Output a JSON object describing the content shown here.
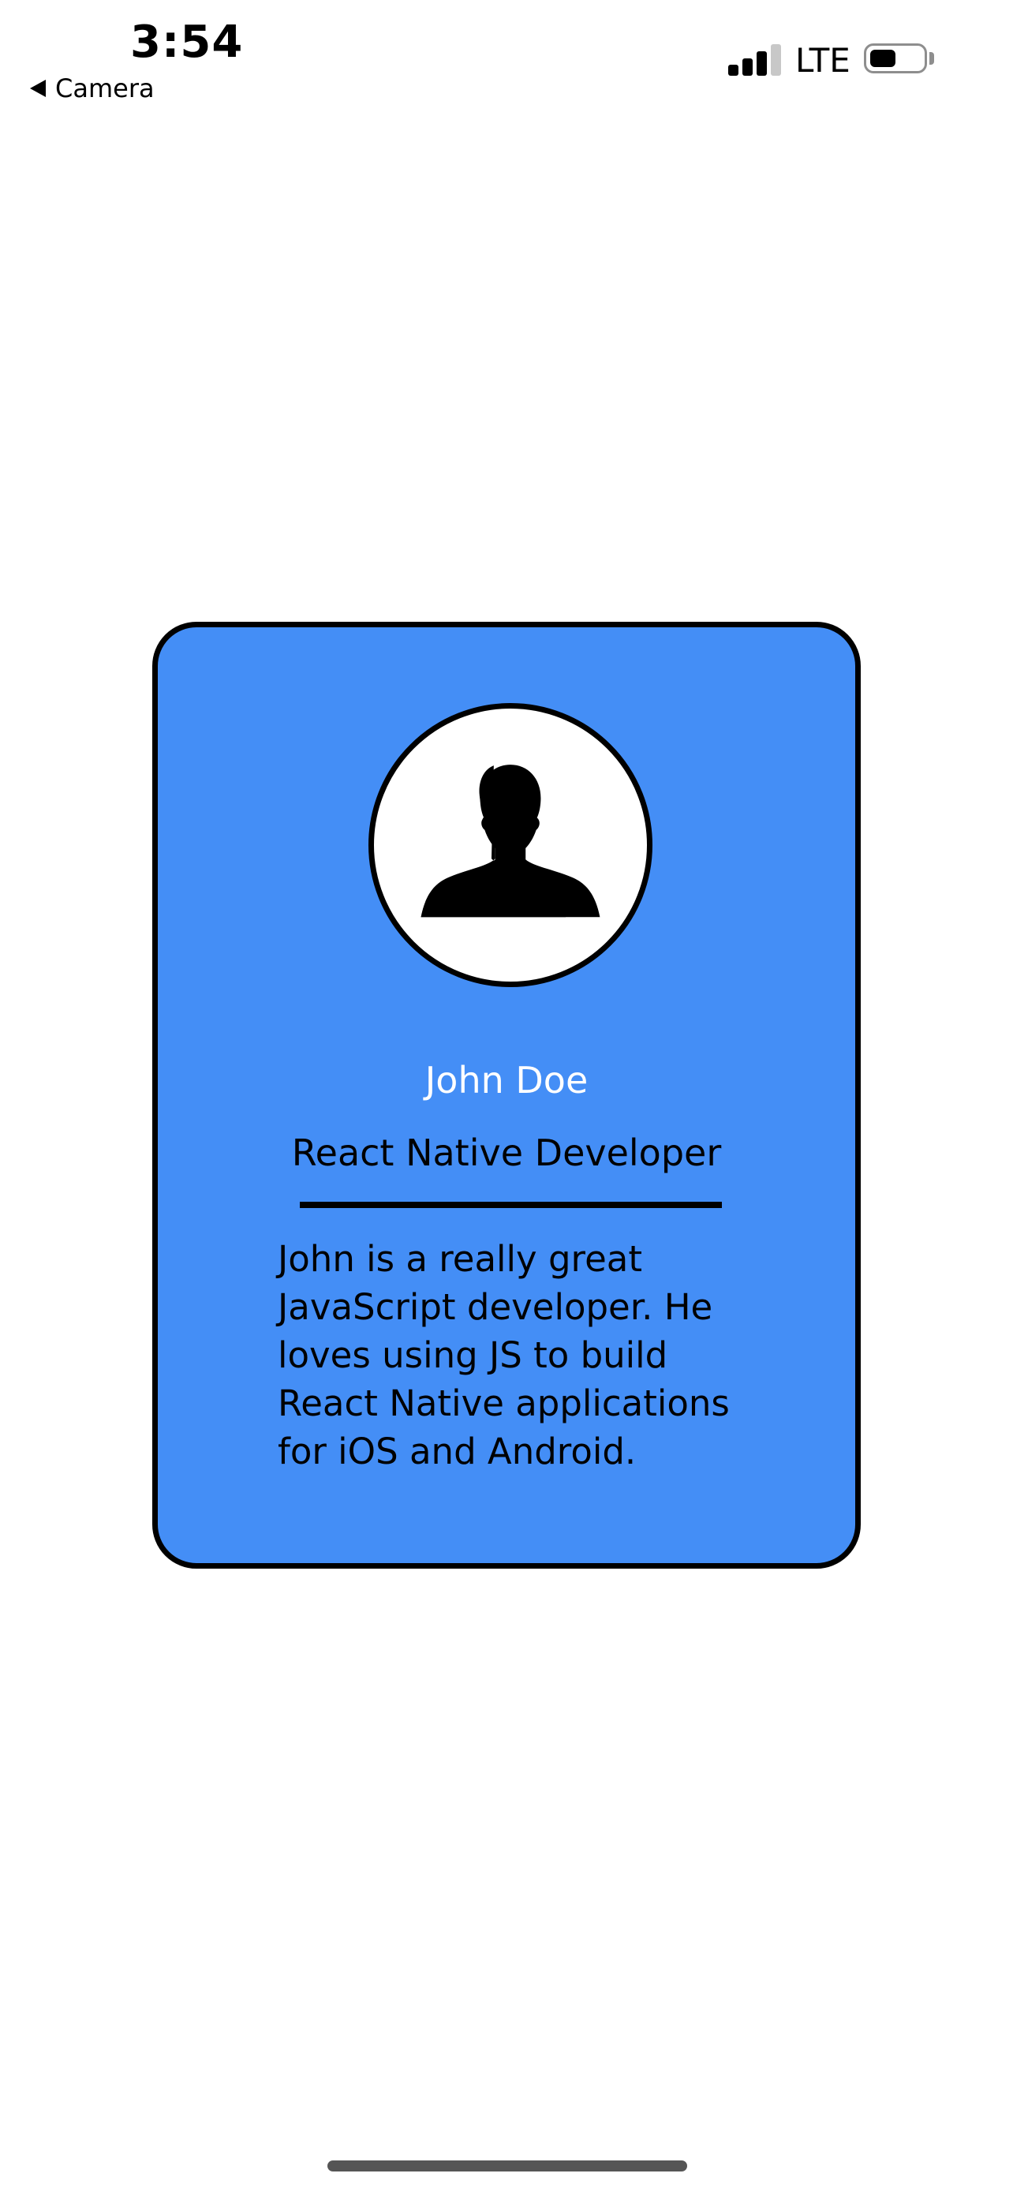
{
  "status_bar": {
    "time": "3:54",
    "back_label": "Camera",
    "network": "LTE",
    "signal_icon": "cellular-signal-icon",
    "battery_icon": "battery-icon",
    "battery_level": 0.5
  },
  "card": {
    "name": "John Doe",
    "role": "React Native Developer",
    "bio": "John is a really great JavaScript developer. He loves using JS to build React Native applications for iOS and Android.",
    "avatar_icon": "user-silhouette-icon",
    "colors": {
      "background": "#448ef6",
      "border": "#000000",
      "name_text": "#ffffff",
      "body_text": "#000000"
    }
  }
}
